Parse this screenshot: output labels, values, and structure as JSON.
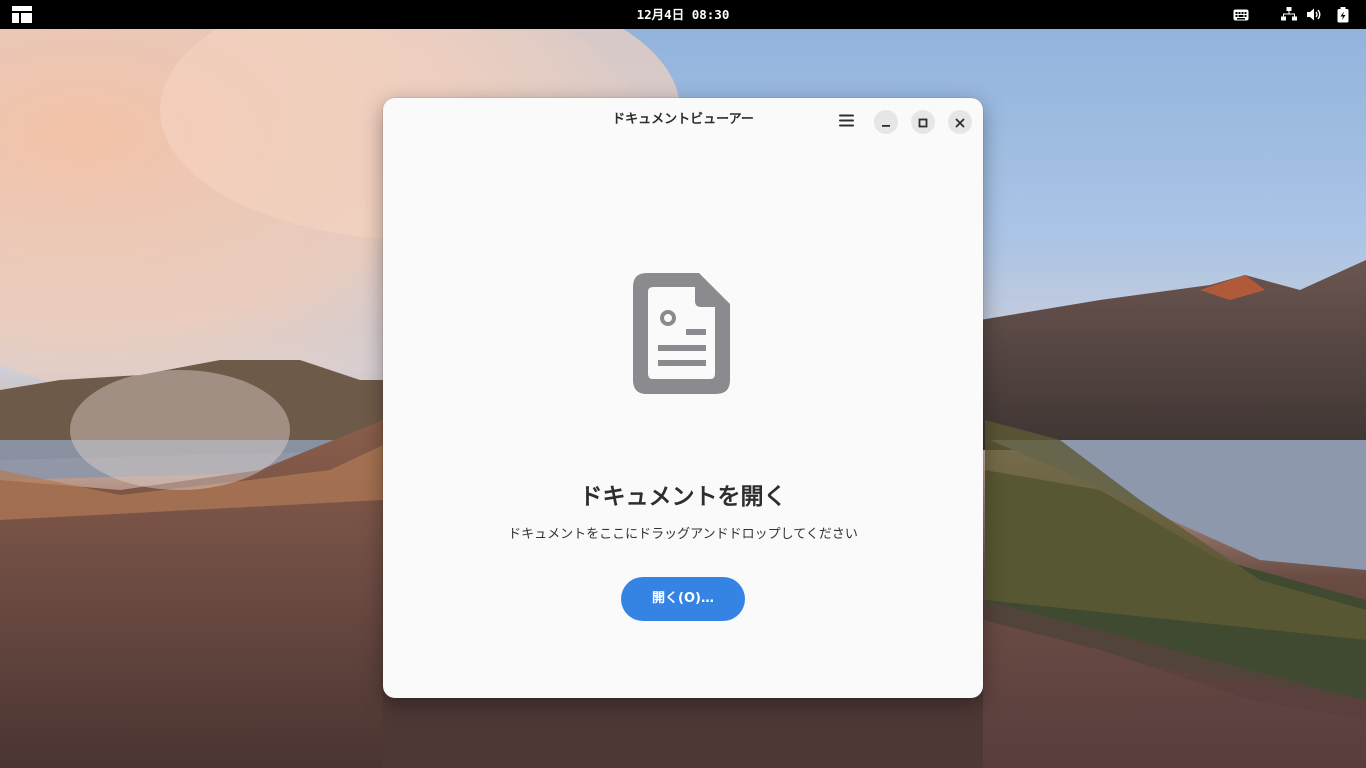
{
  "topbar": {
    "clock": "12月4日 08:30",
    "icons": [
      "activities-icon",
      "keyboard-icon",
      "network-icon",
      "volume-icon",
      "battery-icon"
    ]
  },
  "window": {
    "title": "ドキュメントビューアー",
    "controls": [
      "menu-icon",
      "minimize-icon",
      "maximize-icon",
      "close-icon"
    ],
    "status": {
      "icon": "document-icon",
      "title": "ドキュメントを開く",
      "description": "ドキュメントをここにドラッグアンドドロップしてください",
      "button_label": "開く(O)…"
    }
  },
  "colors": {
    "accent": "#3584e4",
    "window_bg": "#fafafa",
    "topbar_bg": "#000000",
    "icon_gray": "#8b8b8f"
  }
}
